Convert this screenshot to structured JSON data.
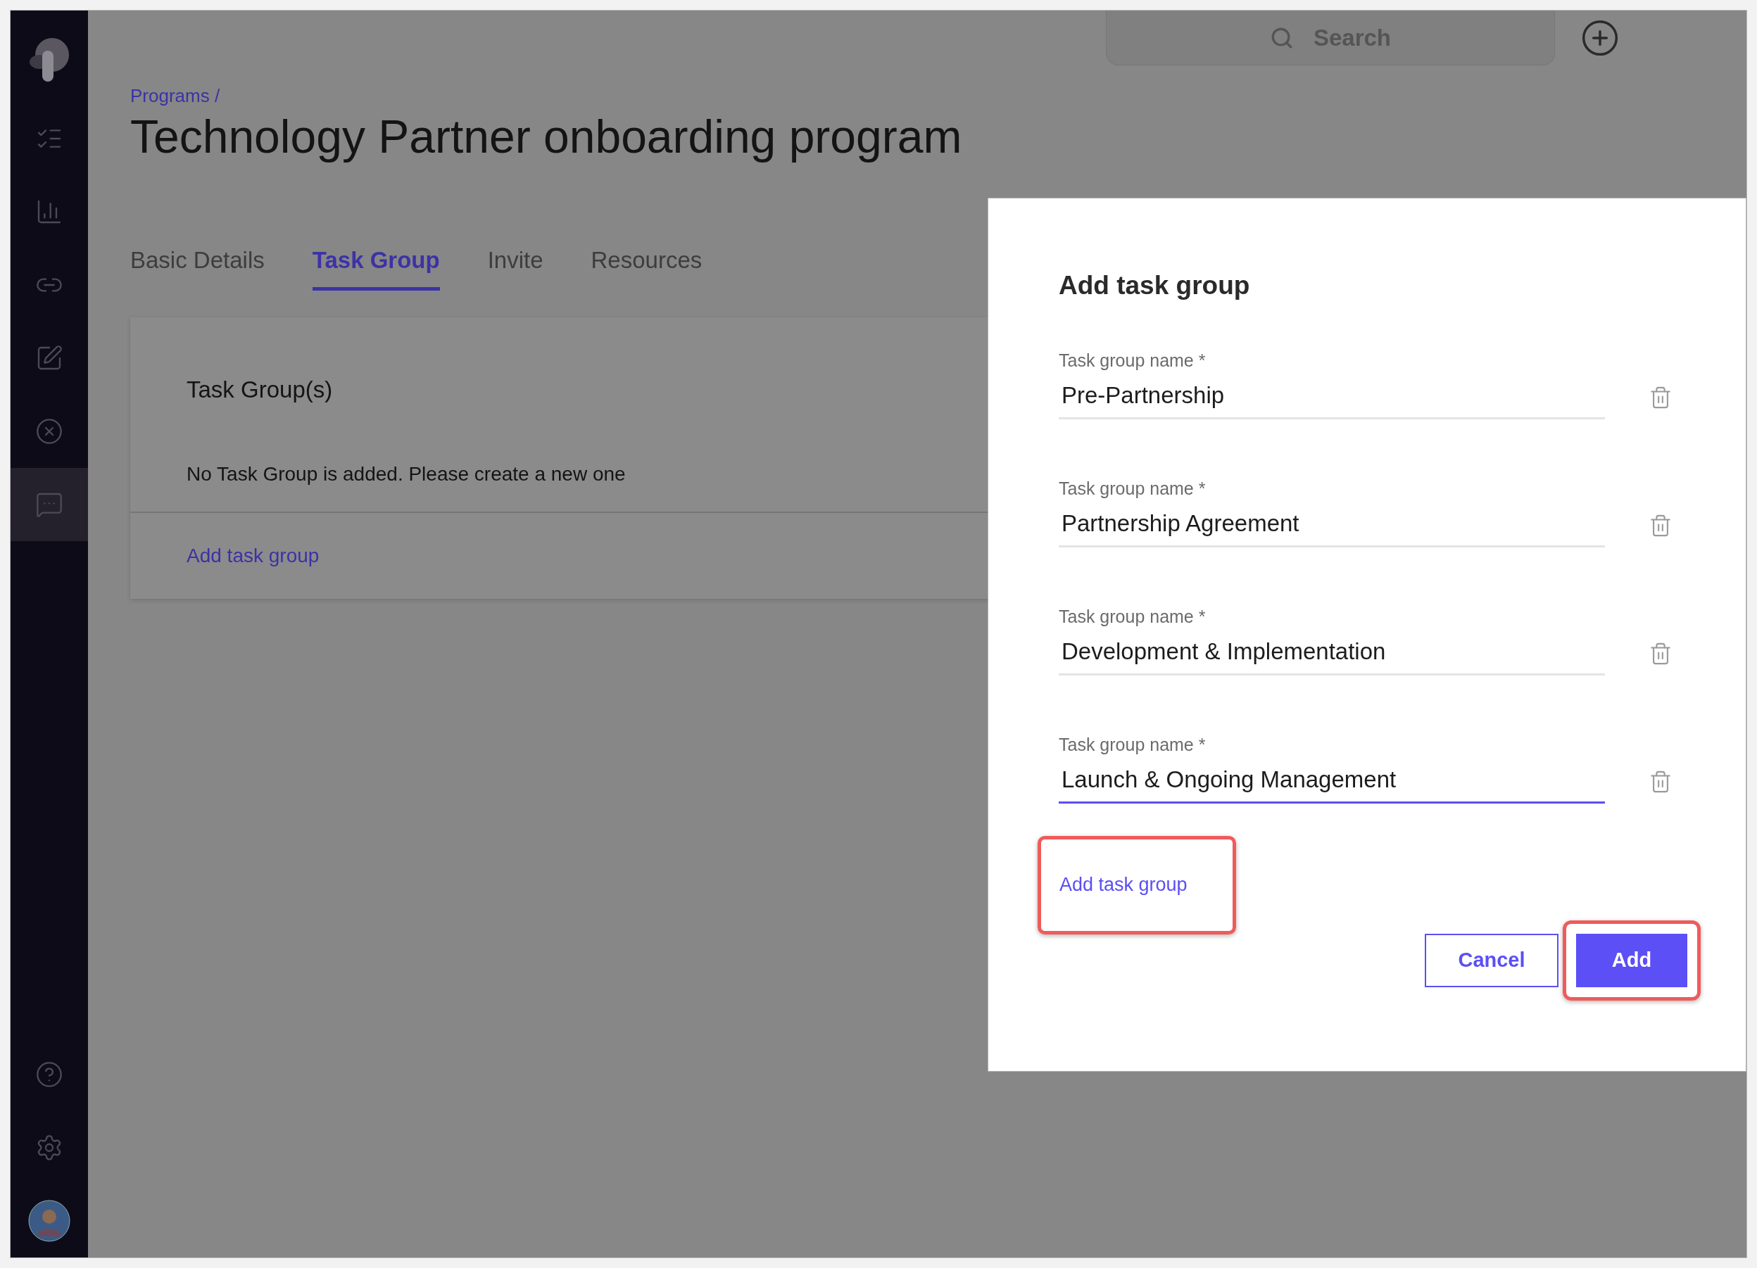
{
  "sidebar": {
    "items": [
      {
        "selected": false
      },
      {
        "selected": false
      },
      {
        "selected": false
      },
      {
        "selected": false
      },
      {
        "selected": false
      },
      {
        "selected": true
      }
    ]
  },
  "search": {
    "placeholder": "Search"
  },
  "breadcrumb": "Programs /",
  "title": "Technology Partner onboarding program",
  "tabs": [
    {
      "label": "Basic Details",
      "selected": false
    },
    {
      "label": "Task Group",
      "selected": true
    },
    {
      "label": "Invite",
      "selected": false
    },
    {
      "label": "Resources",
      "selected": false
    }
  ],
  "card": {
    "heading": "Task Group(s)",
    "message": "No Task Group is added. Please create a new one",
    "link": "Add task group"
  },
  "dialog": {
    "title": "Add task group",
    "fields": [
      {
        "label": "Task group name *",
        "value": "Pre-Partnership",
        "focused": false
      },
      {
        "label": "Task group name *",
        "value": "Partnership Agreement",
        "focused": false
      },
      {
        "label": "Task group name *",
        "value": "Development & Implementation",
        "focused": false
      },
      {
        "label": "Task group name *",
        "value": "Launch & Ongoing Management",
        "focused": true
      }
    ],
    "add_link": "Add task group",
    "buttons": [
      {
        "label": "Cancel",
        "kind": "secondary"
      },
      {
        "label": "Add",
        "kind": "primary"
      }
    ]
  }
}
